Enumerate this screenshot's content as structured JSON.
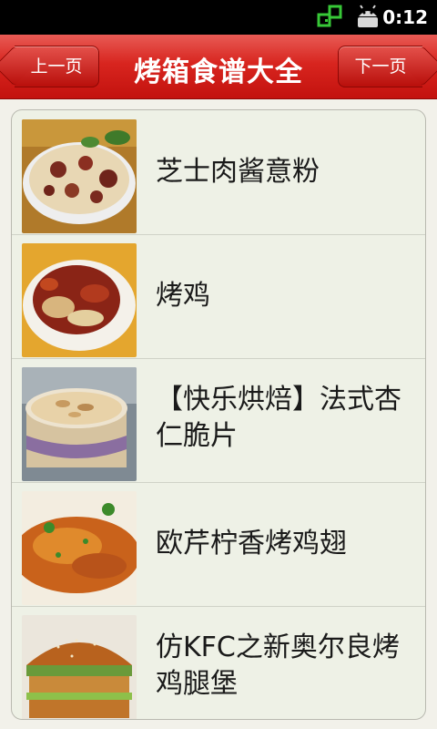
{
  "status_bar": {
    "time": "0:12",
    "icons": [
      "sync-icon",
      "android-usb-icon"
    ]
  },
  "header": {
    "title": "烤箱食谱大全",
    "prev_label": "上一页",
    "next_label": "下一页"
  },
  "recipes": [
    {
      "title": "芝士肉酱意粉",
      "image": "baked-pasta-image"
    },
    {
      "title": "烤鸡",
      "image": "roast-chicken-image"
    },
    {
      "title": "【快乐烘焙】法式杏仁脆片",
      "image": "almond-crisps-image"
    },
    {
      "title": "欧芹柠香烤鸡翅",
      "image": "chicken-wings-image"
    },
    {
      "title": "仿KFC之新奥尔良烤鸡腿堡",
      "image": "chicken-burger-image"
    }
  ],
  "colors": {
    "header_red": "#d8251f",
    "list_background": "#eef1e6"
  }
}
